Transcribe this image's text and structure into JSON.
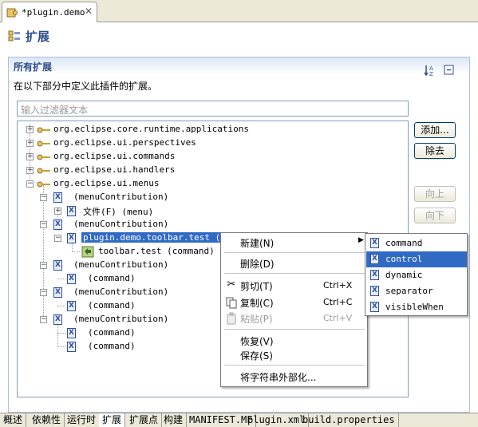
{
  "editor_tab": {
    "title": "*plugin.demo",
    "close": "✕"
  },
  "page": {
    "title": "扩展"
  },
  "section": {
    "title": "所有扩展",
    "description": "在以下部分中定义此插件的扩展。"
  },
  "filter": {
    "placeholder": "输入过滤器文本"
  },
  "tree": {
    "nodes": [
      {
        "label": "org.eclipse.core.runtime.applications"
      },
      {
        "label": "org.eclipse.ui.perspectives"
      },
      {
        "label": "org.eclipse.ui.commands"
      },
      {
        "label": "org.eclipse.ui.handlers"
      },
      {
        "label": "org.eclipse.ui.menus"
      },
      {
        "label": "(menuContribution)"
      },
      {
        "label": "文件(F) (menu)"
      },
      {
        "label": "(menuContribution)"
      },
      {
        "label": "plugin.demo.toolbar.test (too"
      },
      {
        "label": "toolbar.test (command)"
      },
      {
        "label": "(menuContribution)"
      },
      {
        "label": "(command)"
      },
      {
        "label": "(menuContribution)"
      },
      {
        "label": "(command)"
      },
      {
        "label": "(menuContribution)"
      },
      {
        "label": "(command)"
      },
      {
        "label": "(command)"
      }
    ]
  },
  "buttons": {
    "add": "添加...",
    "remove": "除去",
    "up": "向上",
    "down": "向下"
  },
  "context_menu": {
    "new": "新建(N)",
    "delete": "删除(D)",
    "cut": "剪切(T)",
    "cut_key": "Ctrl+X",
    "copy": "复制(C)",
    "copy_key": "Ctrl+C",
    "paste": "粘贴(P)",
    "paste_key": "Ctrl+V",
    "revert": "恢复(V)",
    "save": "保存(S)",
    "externalize": "将字符串外部化..."
  },
  "submenu": {
    "items": [
      "command",
      "control",
      "dynamic",
      "separator",
      "visibleWhen"
    ]
  },
  "bottom_tabs": [
    "概述",
    "依赖性",
    "运行时",
    "扩展",
    "扩展点",
    "构建",
    "MANIFEST.MF",
    "plugin.xml",
    "build.properties"
  ],
  "colors": {
    "selection": "#316ac5",
    "header_title": "#2a4a8b"
  }
}
